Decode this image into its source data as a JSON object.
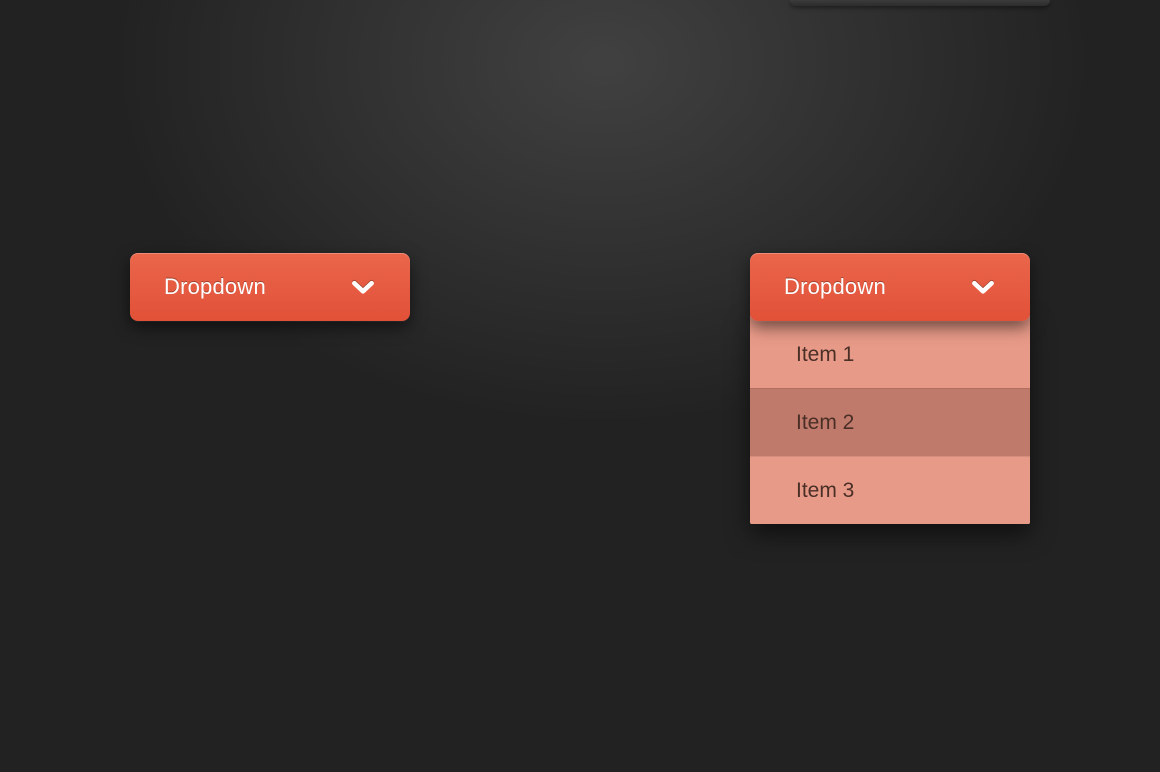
{
  "colors": {
    "button_top": "#ea664b",
    "button_bottom": "#e15138",
    "list_bg": "#e89a88",
    "list_hover": "#c07a6b",
    "text_light": "#ffffff",
    "text_dark": "#4a2f27",
    "page_bg": "#222222"
  },
  "dropdown_closed": {
    "label": "Dropdown"
  },
  "dropdown_open": {
    "label": "Dropdown",
    "items": [
      {
        "label": "Item 1"
      },
      {
        "label": "Item 2"
      },
      {
        "label": "Item 3"
      }
    ],
    "hovered_index": 1
  }
}
